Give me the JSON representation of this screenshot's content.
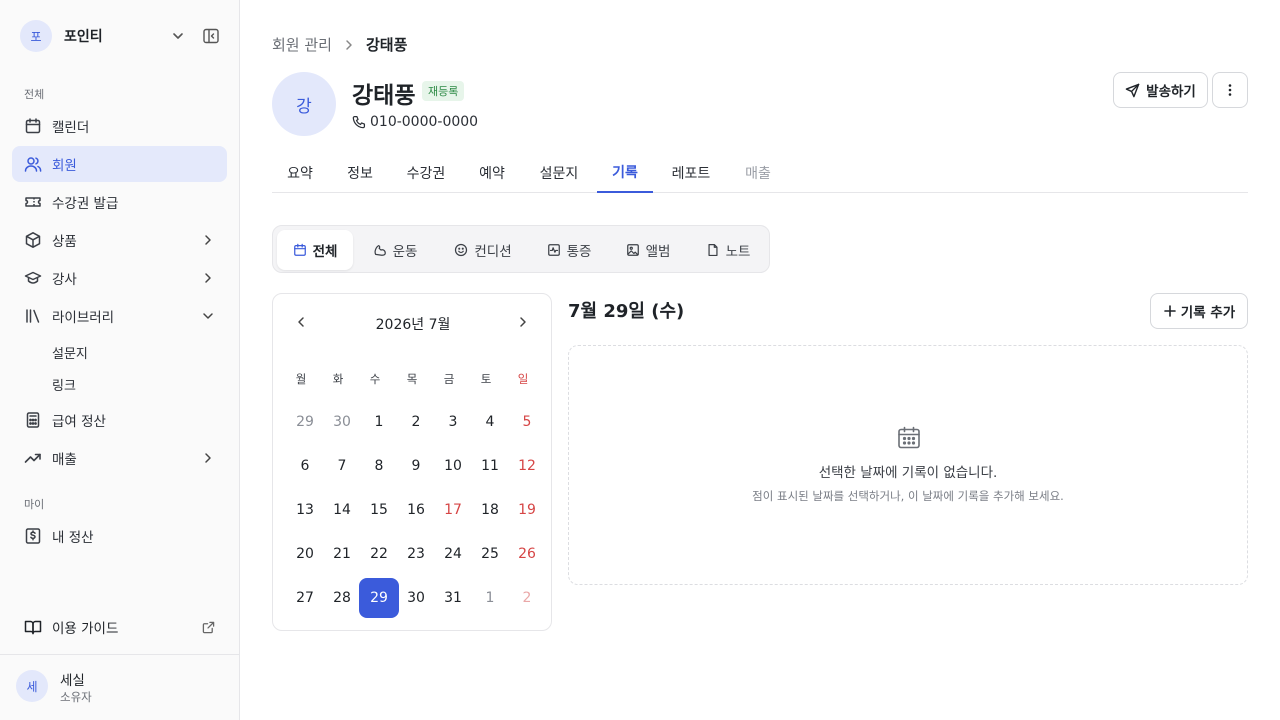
{
  "workspace": {
    "avatar": "포",
    "name": "포인티"
  },
  "sidebar": {
    "section_all": "전체",
    "section_my": "마이",
    "items": [
      {
        "label": "캘린더",
        "icon": "calendar-icon"
      },
      {
        "label": "회원",
        "icon": "users-icon",
        "active": true
      },
      {
        "label": "수강권 발급",
        "icon": "ticket-icon"
      },
      {
        "label": "상품",
        "icon": "box-icon"
      },
      {
        "label": "강사",
        "icon": "graduation-cap-icon"
      },
      {
        "label": "라이브러리",
        "icon": "library-icon"
      },
      {
        "label": "급여 정산",
        "icon": "calculator-icon"
      },
      {
        "label": "매출",
        "icon": "trending-up-icon"
      },
      {
        "label": "내 정산",
        "icon": "dollar-receipt-icon"
      }
    ],
    "library_sub": [
      "설문지",
      "링크"
    ],
    "guide": "이용 가이드",
    "user": {
      "avatar": "세",
      "name": "세실",
      "role": "소유자"
    }
  },
  "breadcrumb": {
    "parent": "회원 관리",
    "current": "강태풍"
  },
  "profile": {
    "avatar": "강",
    "name": "강태풍",
    "badge": "재등록",
    "phone": "010-0000-0000"
  },
  "actions": {
    "send": "발송하기"
  },
  "tabs": [
    "요약",
    "정보",
    "수강권",
    "예약",
    "설문지",
    "기록",
    "레포트",
    "매출"
  ],
  "active_tab": "기록",
  "segments": [
    "전체",
    "운동",
    "컨디션",
    "통증",
    "앨범",
    "노트"
  ],
  "calendar": {
    "title": "2026년 7월",
    "weekdays": [
      "월",
      "화",
      "수",
      "목",
      "금",
      "토",
      "일"
    ],
    "weeks": [
      [
        "29",
        "30",
        "1",
        "2",
        "3",
        "4",
        "5"
      ],
      [
        "6",
        "7",
        "8",
        "9",
        "10",
        "11",
        "12"
      ],
      [
        "13",
        "14",
        "15",
        "16",
        "17",
        "18",
        "19"
      ],
      [
        "20",
        "21",
        "22",
        "23",
        "24",
        "25",
        "26"
      ],
      [
        "27",
        "28",
        "29",
        "30",
        "31",
        "1",
        "2"
      ]
    ],
    "selected": "29",
    "holiday": "17"
  },
  "records": {
    "date_title": "7월 29일 (수)",
    "add_button": "기록 추가",
    "empty_title": "선택한 날짜에 기록이 없습니다.",
    "empty_desc": "점이 표시된 날짜를 선택하거나, 이 날짜에 기록을 추가해 보세요."
  },
  "colors": {
    "accent": "#3b5bdb",
    "accent_bg": "#e4e9fb",
    "sunday": "#d64545",
    "badge_bg": "#e7f5ea",
    "badge_fg": "#2e8b46"
  }
}
